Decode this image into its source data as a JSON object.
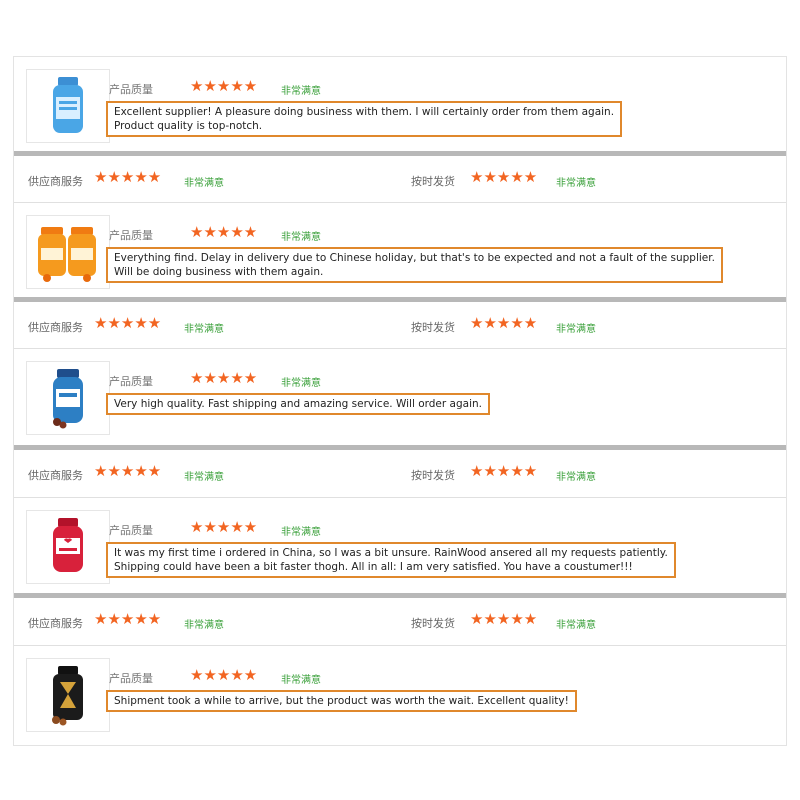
{
  "labels": {
    "product_quality": "产品质量",
    "supplier_service": "供应商服务",
    "on_time_shipping": "按时发货",
    "very_satisfied": "非常满意",
    "stars": "★★★★★"
  },
  "colors": {
    "star": "#f26522",
    "satisfied": "#3aa03a",
    "highlight_border": "#e0882c"
  },
  "reviews": [
    {
      "product_icon": "blue-gummy-bottle-icon",
      "lines": [
        "Excellent supplier! A pleasure doing business with them. I will certainly order from them again.",
        "Product quality is top-notch."
      ]
    },
    {
      "product_icon": "orange-gummy-jars-icon",
      "lines": [
        "Everything find. Delay in delivery due to Chinese holiday, but that's to be expected and not a fault of the supplier.",
        "Will be doing business with them again."
      ]
    },
    {
      "product_icon": "blue-supplement-bottle-icon",
      "lines": [
        "Very high quality. Fast shipping and amazing service. Will order again."
      ]
    },
    {
      "product_icon": "red-gummy-bottle-icon",
      "lines": [
        "It was my first time i ordered in China, so I was a bit unsure. RainWood ansered all my requests patiently.",
        "Shipping could have been a bit faster thogh. All in all: I am very satisfied. You have a coustumer!!!"
      ]
    },
    {
      "product_icon": "black-gold-bottle-icon",
      "lines": [
        "Shipment took a while to arrive, but the product was worth the wait. Excellent quality!"
      ]
    }
  ]
}
